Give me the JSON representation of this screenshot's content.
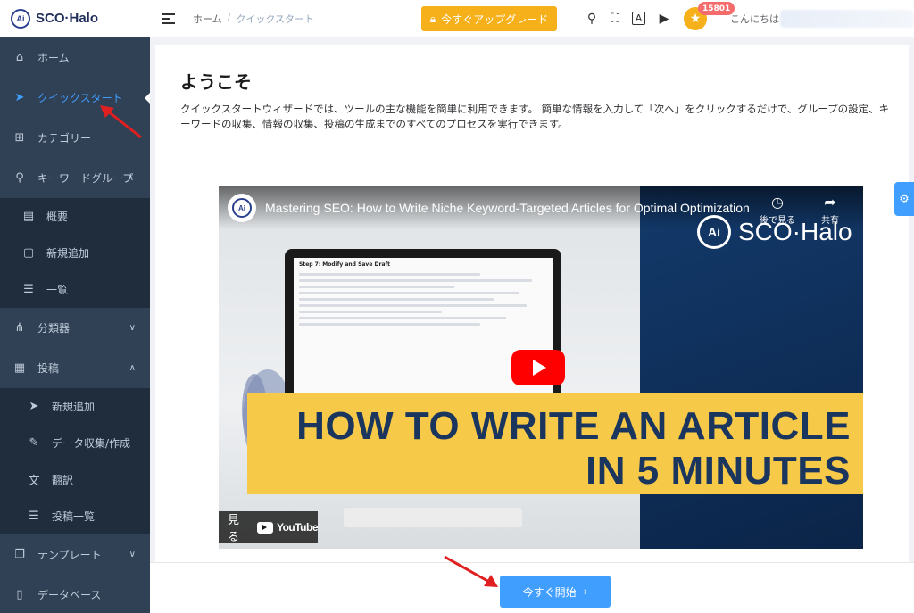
{
  "app": {
    "logo_badge": "Ai",
    "logo_text": "SCO·Halo"
  },
  "sidebar": {
    "items": [
      {
        "label": "ホーム",
        "icon": "home-icon"
      },
      {
        "label": "クイックスタート",
        "icon": "paper-plane-icon",
        "active": true
      },
      {
        "label": "カテゴリー",
        "icon": "sitemap-icon"
      },
      {
        "label": "キーワードグループ",
        "icon": "search-icon",
        "expanded": true
      }
    ],
    "keyword_sub": [
      {
        "label": "概要",
        "icon": "list-alt-icon"
      },
      {
        "label": "新規追加",
        "icon": "new-doc-icon"
      },
      {
        "label": "一覧",
        "icon": "list-icon"
      }
    ],
    "classifier": {
      "label": "分類器",
      "icon": "share-nodes-icon"
    },
    "posts": {
      "label": "投稿",
      "icon": "article-icon"
    },
    "posts_sub": [
      {
        "label": "新規追加",
        "icon": "send-icon"
      },
      {
        "label": "データ収集/作成",
        "icon": "edit-doc-icon"
      },
      {
        "label": "翻訳",
        "icon": "translate-icon"
      },
      {
        "label": "投稿一覧",
        "icon": "list-icon"
      }
    ],
    "templates": {
      "label": "テンプレート",
      "icon": "copy-icon"
    },
    "database": {
      "label": "データベース",
      "icon": "book-icon"
    }
  },
  "header": {
    "breadcrumb_home": "ホーム",
    "breadcrumb_sep": "/",
    "breadcrumb_current": "クイックスタート",
    "upgrade_label": "今すぐアップグレード",
    "notification_count": "15801",
    "greeting": "こんにちは"
  },
  "main": {
    "title": "ようこそ",
    "intro": "クイックスタートウィザードでは、ツールの主な機能を簡単に利用できます。 簡単な情報を入力して「次へ」をクリックするだけで、グループの設定、キーワードの収集、情報の収集、投稿の生成までのすべてのプロセスを実行できます。"
  },
  "video": {
    "channel_badge": "Ai",
    "title": "Mastering SEO: How to Write Niche Keyword-Targeted Articles for Optimal Optimization",
    "watch_later": "後で見る",
    "share": "共有",
    "brand_badge": "Ai",
    "brand_text": "SCO·Halo",
    "screen_title": "Step 7: Modify and Save Draft",
    "banner_line1": "HOW TO WRITE AN ARTICLE",
    "banner_line2": "IN 5 MINUTES",
    "watch_on": "見る",
    "youtube": "YouTube"
  },
  "footer": {
    "start_label": "今すぐ開始",
    "start_chevron": "›"
  },
  "colors": {
    "sidebar": "#304156",
    "accent": "#409eff",
    "upgrade": "#f5b01a",
    "badge": "#f56c6c",
    "banner": "#f7c948",
    "banner_text": "#1a355e",
    "arrow": "#e02020"
  }
}
